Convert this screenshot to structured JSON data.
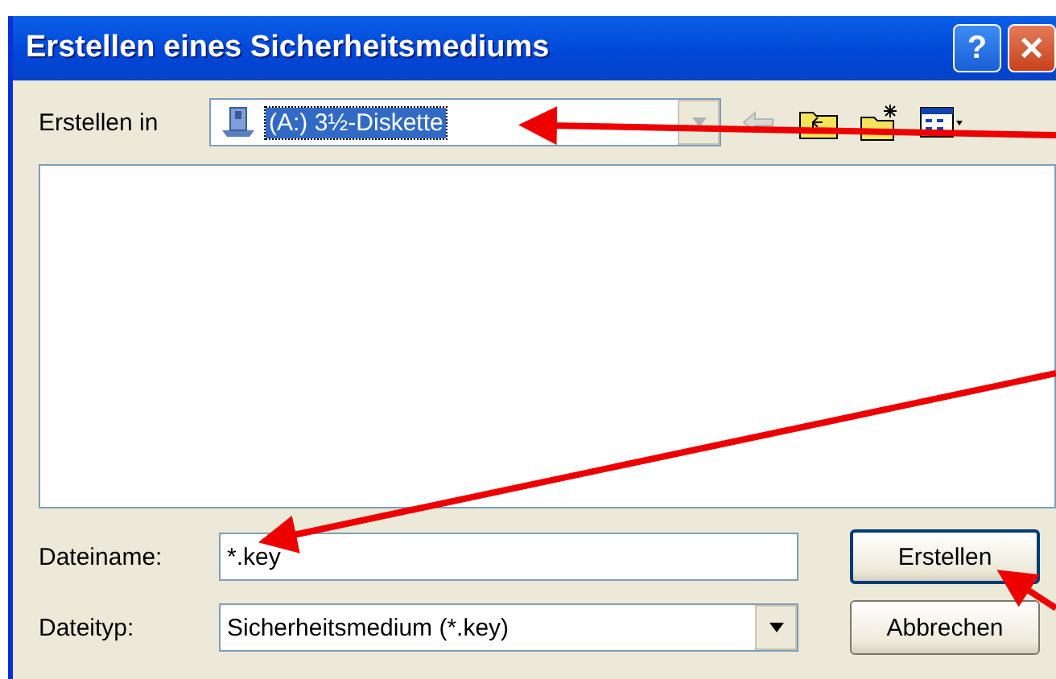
{
  "window": {
    "title": "Erstellen eines Sicherheitsmediums",
    "buttons": [
      "?",
      "✕"
    ]
  },
  "location": {
    "label": "Erstellen in",
    "value": "(A:) 3½-Diskette",
    "selected": true
  },
  "toolbar": [
    {
      "kind": "back",
      "disabled": true
    },
    {
      "kind": "up",
      "disabled": false
    },
    {
      "kind": "newfolder",
      "disabled": false
    },
    {
      "kind": "view",
      "disabled": false
    }
  ],
  "filename": {
    "label": "Dateiname:",
    "value": "*.key"
  },
  "filetype": {
    "label": "Dateityp:",
    "value": "Sicherheitsmedium (*.key)"
  },
  "buttons": [
    {
      "label": "Erstellen",
      "default": true
    },
    {
      "label": "Abbrechen",
      "default": false
    }
  ]
}
